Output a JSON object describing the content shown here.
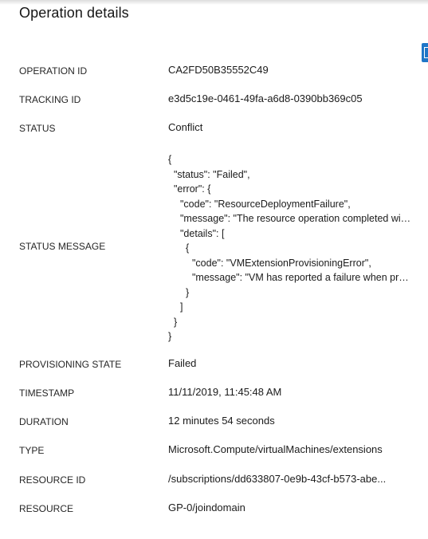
{
  "panel": {
    "title": "Operation details"
  },
  "details": {
    "operation_id": {
      "label": "OPERATION ID",
      "value": "CA2FD50B35552C49"
    },
    "tracking_id": {
      "label": "TRACKING ID",
      "value": "e3d5c19e-0461-49fa-a6d8-0390bb369c05"
    },
    "status": {
      "label": "STATUS",
      "value": "Conflict"
    },
    "status_message": {
      "label": "STATUS MESSAGE",
      "lines": [
        "{",
        "\"status\": \"Failed\",",
        "\"error\": {",
        "\"code\": \"ResourceDeploymentFailure\",",
        "\"message\": \"The resource operation completed with terminal provisioning state 'Failed'.\",",
        "\"details\": [",
        "{",
        "\"code\": \"VMExtensionProvisioningError\",",
        "\"message\": \"VM has reported a failure when processing extension 'joindomain'.\"",
        "}",
        "]",
        "}",
        "}"
      ]
    },
    "provisioning_state": {
      "label": "PROVISIONING STATE",
      "value": "Failed"
    },
    "timestamp": {
      "label": "TIMESTAMP",
      "value": "11/11/2019, 11:45:48 AM"
    },
    "duration": {
      "label": "DURATION",
      "value": "12 minutes 54 seconds"
    },
    "type": {
      "label": "TYPE",
      "value": "Microsoft.Compute/virtualMachines/extensions"
    },
    "resource_id": {
      "label": "RESOURCE ID",
      "value": "/subscriptions/dd633807-0e9b-43cf-b573-abe..."
    },
    "resource": {
      "label": "RESOURCE",
      "value": "GP-0/joindomain"
    }
  },
  "icons": {
    "edge_tab": "panel-expand-icon"
  }
}
